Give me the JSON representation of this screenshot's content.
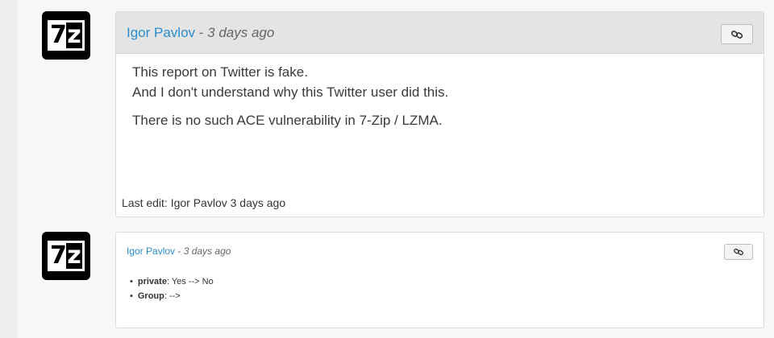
{
  "posts": [
    {
      "author": "Igor Pavlov",
      "separator": " - ",
      "time": "3 days ago",
      "avatar": {
        "left": "7",
        "right": "z"
      },
      "icon": "link-icon",
      "body": [
        "This report on Twitter is fake.",
        "And I don't understand why this Twitter user did this.",
        "There is no such ACE vulnerability in 7-Zip / LZMA."
      ],
      "last_edit": "Last edit: Igor Pavlov 3 days ago"
    },
    {
      "author": "Igor Pavlov",
      "separator": " - ",
      "time": "3 days ago",
      "avatar": {
        "left": "7",
        "right": "z"
      },
      "icon": "link-icon",
      "changes": [
        {
          "field": "private",
          "change": ": Yes --> No"
        },
        {
          "field": "Group",
          "change": ": -->"
        }
      ]
    }
  ],
  "colors": {
    "author_link": "#2a8cd0",
    "header_bg": "#e4e4e4",
    "page_bg": "#f7f7f7"
  }
}
